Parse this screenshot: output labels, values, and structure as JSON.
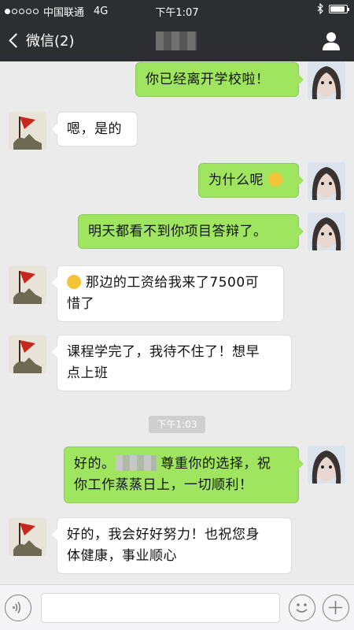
{
  "status_bar": {
    "carrier": "中国联通",
    "network": "4G",
    "time": "下午1:07",
    "signal_strength": 1,
    "battery_level": 0.9
  },
  "nav": {
    "back_label": "微信(2)",
    "title_blurred": true,
    "icons": {
      "back": "chevron-left-icon",
      "profile": "person-icon"
    }
  },
  "messages": [
    {
      "side": "right",
      "text": "你已经离开学校啦！"
    },
    {
      "side": "left",
      "text": "嗯，是的"
    },
    {
      "side": "right",
      "text": "为什么呢",
      "emoji": "sad-face-emoji"
    },
    {
      "side": "right",
      "text": "明天都看不到你项目答辩了。"
    },
    {
      "side": "left",
      "line1": "那边的工资给我来了7500可",
      "line2": "惜了",
      "emoji": "grin-face-emoji"
    },
    {
      "side": "left",
      "line1": "课程学完了，我待不住了！想早",
      "line2": "点上班"
    },
    {
      "side": "right",
      "line1_pre": "好的。",
      "line1_post": " 尊重你的选择，祝",
      "line2": "你工作蒸蒸日上，一切顺利！"
    },
    {
      "side": "left",
      "line1": "好的，我会好好努力！也祝您身",
      "line2": "体健康，事业顺心"
    }
  ],
  "timestamp": "下午1:03",
  "colors": {
    "sent_bubble": "#9fe55f",
    "received_bubble": "#ffffff",
    "header": "#2d2e32",
    "chat_bg": "#ebebeb"
  },
  "input_bar": {
    "icons": {
      "voice": "voice-icon",
      "emoji": "smiley-icon",
      "more": "plus-icon"
    }
  }
}
